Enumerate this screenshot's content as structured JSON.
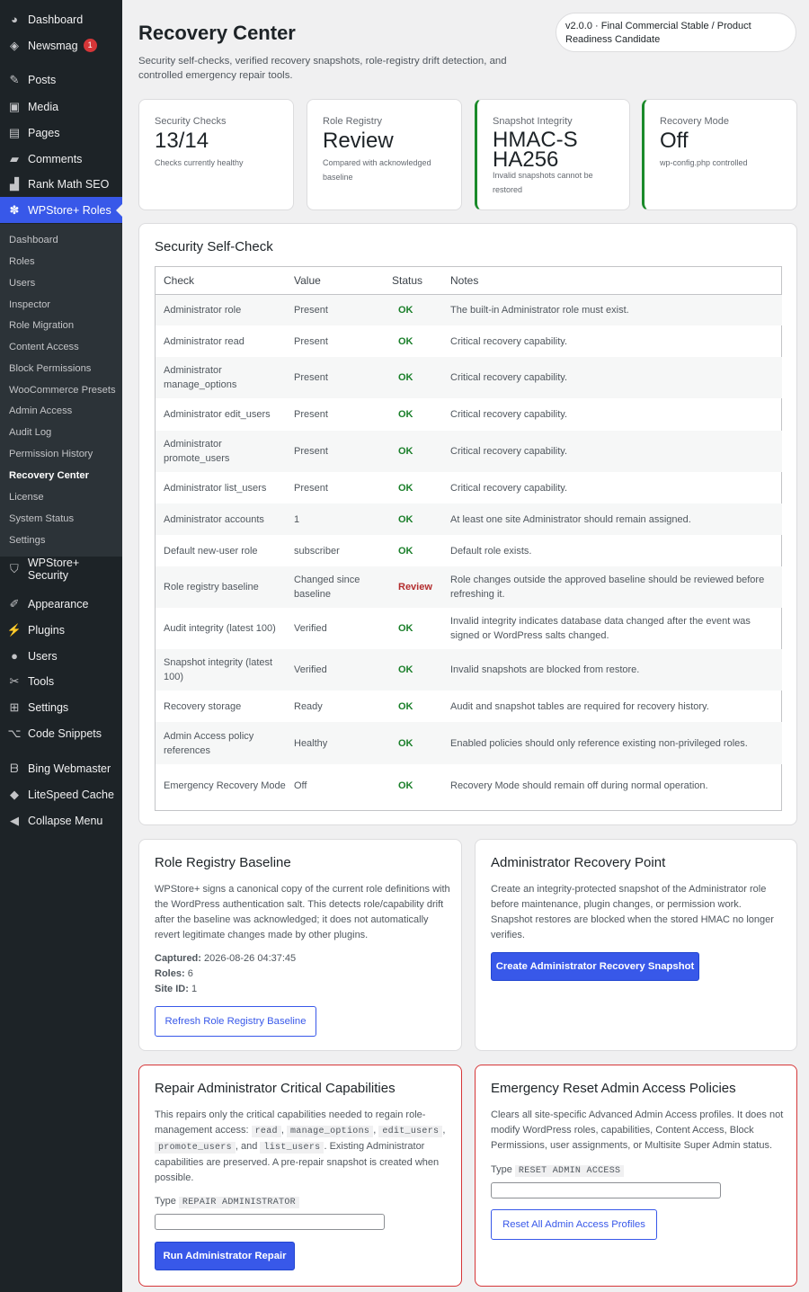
{
  "sidebar": {
    "items": [
      {
        "label": "Dashboard",
        "icon": "dashboard-icon"
      },
      {
        "label": "Newsmag",
        "icon": "newsmag-icon",
        "badge": "1"
      },
      {
        "label": "Posts",
        "icon": "pin-icon"
      },
      {
        "label": "Media",
        "icon": "media-icon"
      },
      {
        "label": "Pages",
        "icon": "pages-icon"
      },
      {
        "label": "Comments",
        "icon": "comments-icon"
      },
      {
        "label": "Rank Math SEO",
        "icon": "chart-icon"
      },
      {
        "label": "WPStore+ Roles",
        "icon": "roles-icon"
      },
      {
        "label": "WPStore+ Security",
        "icon": "shield-icon"
      },
      {
        "label": "Appearance",
        "icon": "brush-icon"
      },
      {
        "label": "Plugins",
        "icon": "plugin-icon"
      },
      {
        "label": "Users",
        "icon": "user-icon"
      },
      {
        "label": "Tools",
        "icon": "wrench-icon"
      },
      {
        "label": "Settings",
        "icon": "settings-icon"
      },
      {
        "label": "Code Snippets",
        "icon": "code-icon"
      },
      {
        "label": "Bing Webmaster",
        "icon": "bing-icon"
      },
      {
        "label": "LiteSpeed Cache",
        "icon": "diamond-icon"
      },
      {
        "label": "Collapse Menu",
        "icon": "collapse-icon"
      }
    ],
    "submenu": [
      "Dashboard",
      "Roles",
      "Users",
      "Inspector",
      "Role Migration",
      "Content Access",
      "Block Permissions",
      "WooCommerce Presets",
      "Admin Access",
      "Audit Log",
      "Permission History",
      "Recovery Center",
      "License",
      "System Status",
      "Settings"
    ]
  },
  "header": {
    "title": "Recovery Center",
    "subtitle": "Security self-checks, verified recovery snapshots, role-registry drift detection, and controlled emergency repair tools.",
    "version": "v2.0.0 · Final Commercial Stable / Product Readiness Candidate"
  },
  "stats": [
    {
      "label": "Security Checks",
      "value": "13/14",
      "note": "Checks currently healthy"
    },
    {
      "label": "Role Registry",
      "value": "Review",
      "note": "Compared with acknowledged baseline"
    },
    {
      "label": "Snapshot Integrity",
      "value": "HMAC-SHA256",
      "note": "Invalid snapshots cannot be restored"
    },
    {
      "label": "Recovery Mode",
      "value": "Off",
      "note": "wp-config.php controlled"
    }
  ],
  "selfcheck": {
    "title": "Security Self-Check",
    "columns": [
      "Check",
      "Value",
      "Status",
      "Notes"
    ],
    "rows": [
      [
        "Administrator role",
        "Present",
        "OK",
        "The built-in Administrator role must exist."
      ],
      [
        "Administrator read",
        "Present",
        "OK",
        "Critical recovery capability."
      ],
      [
        "Administrator manage_options",
        "Present",
        "OK",
        "Critical recovery capability."
      ],
      [
        "Administrator edit_users",
        "Present",
        "OK",
        "Critical recovery capability."
      ],
      [
        "Administrator promote_users",
        "Present",
        "OK",
        "Critical recovery capability."
      ],
      [
        "Administrator list_users",
        "Present",
        "OK",
        "Critical recovery capability."
      ],
      [
        "Administrator accounts",
        "1",
        "OK",
        "At least one site Administrator should remain assigned."
      ],
      [
        "Default new-user role",
        "subscriber",
        "OK",
        "Default role exists."
      ],
      [
        "Role registry baseline",
        "Changed since baseline",
        "Review",
        "Role changes outside the approved baseline should be reviewed before refreshing it."
      ],
      [
        "Audit integrity (latest 100)",
        "Verified",
        "OK",
        "Invalid integrity indicates database data changed after the event was signed or WordPress salts changed."
      ],
      [
        "Snapshot integrity (latest 100)",
        "Verified",
        "OK",
        "Invalid snapshots are blocked from restore."
      ],
      [
        "Recovery storage",
        "Ready",
        "OK",
        "Audit and snapshot tables are required for recovery history."
      ],
      [
        "Admin Access policy references",
        "Healthy",
        "OK",
        "Enabled policies should only reference existing non-privileged roles."
      ],
      [
        "Emergency Recovery Mode",
        "Off",
        "OK",
        "Recovery Mode should remain off during normal operation."
      ]
    ]
  },
  "baseline": {
    "title": "Role Registry Baseline",
    "text": "WPStore+ signs a canonical copy of the current role definitions with the WordPress authentication salt. This detects role/capability drift after the baseline was acknowledged; it does not automatically revert legitimate changes made by other plugins.",
    "captured_label": "Captured:",
    "captured": "2026-08-26 04:37:45",
    "roles_label": "Roles:",
    "roles": "6",
    "site_label": "Site ID:",
    "site": "1",
    "button": "Refresh Role Registry Baseline"
  },
  "recovery_point": {
    "title": "Administrator Recovery Point",
    "text": "Create an integrity-protected snapshot of the Administrator role before maintenance, plugin changes, or permission work. Snapshot restores are blocked when the stored HMAC no longer verifies.",
    "button": "Create Administrator Recovery Snapshot"
  },
  "repair": {
    "title": "Repair Administrator Critical Capabilities",
    "t1": "This repairs only the critical capabilities needed to regain role-management access:",
    "c1": "read",
    "c2": "manage_options",
    "c3": "edit_users",
    "c4": "promote_users",
    "and": ", and",
    "c5": "list_users",
    "t2": ". Existing Administrator capabilities are preserved. A pre-repair snapshot is created when possible.",
    "type_label": "Type",
    "type_code": "REPAIR ADMINISTRATOR",
    "button": "Run Administrator Repair"
  },
  "reset": {
    "title": "Emergency Reset Admin Access Policies",
    "text": "Clears all site-specific Advanced Admin Access profiles. It does not modify WordPress roles, capabilities, Content Access, Block Permissions, user assignments, or Multisite Super Admin status.",
    "type_label": "Type",
    "type_code": "RESET ADMIN ACCESS",
    "button": "Reset All Admin Access Profiles"
  },
  "colors": {
    "accent": "#3858e9",
    "ok": "#1a7f2a",
    "review": "#b32d2e",
    "danger_border": "#d63638",
    "sidebar": "#1d2327"
  }
}
